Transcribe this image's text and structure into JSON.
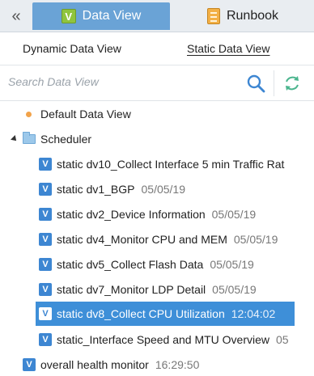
{
  "header": {
    "collapse_icon": "double-chevron-left-icon",
    "tabs": [
      {
        "label": "Data View",
        "active": true,
        "icon": "data-view-logo-icon"
      },
      {
        "label": "Runbook",
        "active": false,
        "icon": "runbook-book-icon"
      }
    ]
  },
  "subtabs": [
    {
      "label": "Dynamic Data View",
      "active": false
    },
    {
      "label": "Static Data View",
      "active": true
    }
  ],
  "search": {
    "placeholder": "Search Data View",
    "value": ""
  },
  "tree": {
    "default_item": {
      "label": "Default Data View"
    },
    "folder": {
      "label": "Scheduler",
      "expanded": true,
      "items": [
        {
          "label": "static dv10_Collect Interface 5 min Traffic Rat",
          "time": "",
          "selected": false
        },
        {
          "label": "static dv1_BGP",
          "time": "05/05/19",
          "selected": false
        },
        {
          "label": "static dv2_Device Information",
          "time": "05/05/19",
          "selected": false
        },
        {
          "label": "static dv4_Monitor CPU and MEM",
          "time": "05/05/19",
          "selected": false
        },
        {
          "label": "static dv5_Collect Flash Data",
          "time": "05/05/19",
          "selected": false
        },
        {
          "label": "static dv7_Monitor LDP Detail",
          "time": "05/05/19",
          "selected": false
        },
        {
          "label": "static dv8_Collect CPU Utilization",
          "time": "12:04:02",
          "selected": true
        },
        {
          "label": "static_Interface Speed and MTU Overview",
          "time": "05",
          "selected": false
        }
      ]
    },
    "root_item": {
      "label": "overall health monitor",
      "time": "16:29:50"
    }
  },
  "colors": {
    "tab_active_bg": "#6aa3d6",
    "selected_row_bg": "#3e8fd8",
    "view_icon": "#3d86d2",
    "default_dot": "#f2a34a"
  }
}
